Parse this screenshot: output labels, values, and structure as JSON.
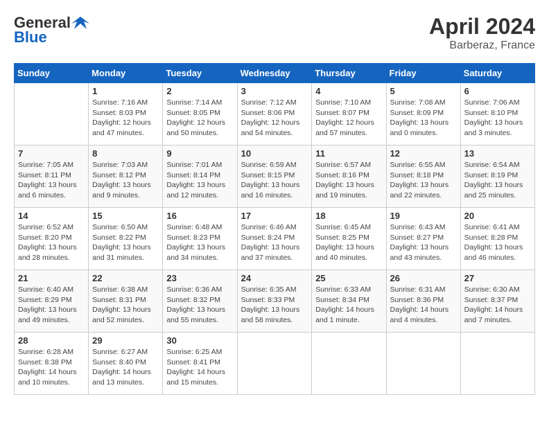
{
  "header": {
    "logo_general": "General",
    "logo_blue": "Blue",
    "month_year": "April 2024",
    "location": "Barberaz, France"
  },
  "days_of_week": [
    "Sunday",
    "Monday",
    "Tuesday",
    "Wednesday",
    "Thursday",
    "Friday",
    "Saturday"
  ],
  "weeks": [
    [
      {
        "day": "",
        "sunrise": "",
        "sunset": "",
        "daylight": ""
      },
      {
        "day": "1",
        "sunrise": "Sunrise: 7:16 AM",
        "sunset": "Sunset: 8:03 PM",
        "daylight": "Daylight: 12 hours and 47 minutes."
      },
      {
        "day": "2",
        "sunrise": "Sunrise: 7:14 AM",
        "sunset": "Sunset: 8:05 PM",
        "daylight": "Daylight: 12 hours and 50 minutes."
      },
      {
        "day": "3",
        "sunrise": "Sunrise: 7:12 AM",
        "sunset": "Sunset: 8:06 PM",
        "daylight": "Daylight: 12 hours and 54 minutes."
      },
      {
        "day": "4",
        "sunrise": "Sunrise: 7:10 AM",
        "sunset": "Sunset: 8:07 PM",
        "daylight": "Daylight: 12 hours and 57 minutes."
      },
      {
        "day": "5",
        "sunrise": "Sunrise: 7:08 AM",
        "sunset": "Sunset: 8:09 PM",
        "daylight": "Daylight: 13 hours and 0 minutes."
      },
      {
        "day": "6",
        "sunrise": "Sunrise: 7:06 AM",
        "sunset": "Sunset: 8:10 PM",
        "daylight": "Daylight: 13 hours and 3 minutes."
      }
    ],
    [
      {
        "day": "7",
        "sunrise": "Sunrise: 7:05 AM",
        "sunset": "Sunset: 8:11 PM",
        "daylight": "Daylight: 13 hours and 6 minutes."
      },
      {
        "day": "8",
        "sunrise": "Sunrise: 7:03 AM",
        "sunset": "Sunset: 8:12 PM",
        "daylight": "Daylight: 13 hours and 9 minutes."
      },
      {
        "day": "9",
        "sunrise": "Sunrise: 7:01 AM",
        "sunset": "Sunset: 8:14 PM",
        "daylight": "Daylight: 13 hours and 12 minutes."
      },
      {
        "day": "10",
        "sunrise": "Sunrise: 6:59 AM",
        "sunset": "Sunset: 8:15 PM",
        "daylight": "Daylight: 13 hours and 16 minutes."
      },
      {
        "day": "11",
        "sunrise": "Sunrise: 6:57 AM",
        "sunset": "Sunset: 8:16 PM",
        "daylight": "Daylight: 13 hours and 19 minutes."
      },
      {
        "day": "12",
        "sunrise": "Sunrise: 6:55 AM",
        "sunset": "Sunset: 8:18 PM",
        "daylight": "Daylight: 13 hours and 22 minutes."
      },
      {
        "day": "13",
        "sunrise": "Sunrise: 6:54 AM",
        "sunset": "Sunset: 8:19 PM",
        "daylight": "Daylight: 13 hours and 25 minutes."
      }
    ],
    [
      {
        "day": "14",
        "sunrise": "Sunrise: 6:52 AM",
        "sunset": "Sunset: 8:20 PM",
        "daylight": "Daylight: 13 hours and 28 minutes."
      },
      {
        "day": "15",
        "sunrise": "Sunrise: 6:50 AM",
        "sunset": "Sunset: 8:22 PM",
        "daylight": "Daylight: 13 hours and 31 minutes."
      },
      {
        "day": "16",
        "sunrise": "Sunrise: 6:48 AM",
        "sunset": "Sunset: 8:23 PM",
        "daylight": "Daylight: 13 hours and 34 minutes."
      },
      {
        "day": "17",
        "sunrise": "Sunrise: 6:46 AM",
        "sunset": "Sunset: 8:24 PM",
        "daylight": "Daylight: 13 hours and 37 minutes."
      },
      {
        "day": "18",
        "sunrise": "Sunrise: 6:45 AM",
        "sunset": "Sunset: 8:25 PM",
        "daylight": "Daylight: 13 hours and 40 minutes."
      },
      {
        "day": "19",
        "sunrise": "Sunrise: 6:43 AM",
        "sunset": "Sunset: 8:27 PM",
        "daylight": "Daylight: 13 hours and 43 minutes."
      },
      {
        "day": "20",
        "sunrise": "Sunrise: 6:41 AM",
        "sunset": "Sunset: 8:28 PM",
        "daylight": "Daylight: 13 hours and 46 minutes."
      }
    ],
    [
      {
        "day": "21",
        "sunrise": "Sunrise: 6:40 AM",
        "sunset": "Sunset: 8:29 PM",
        "daylight": "Daylight: 13 hours and 49 minutes."
      },
      {
        "day": "22",
        "sunrise": "Sunrise: 6:38 AM",
        "sunset": "Sunset: 8:31 PM",
        "daylight": "Daylight: 13 hours and 52 minutes."
      },
      {
        "day": "23",
        "sunrise": "Sunrise: 6:36 AM",
        "sunset": "Sunset: 8:32 PM",
        "daylight": "Daylight: 13 hours and 55 minutes."
      },
      {
        "day": "24",
        "sunrise": "Sunrise: 6:35 AM",
        "sunset": "Sunset: 8:33 PM",
        "daylight": "Daylight: 13 hours and 58 minutes."
      },
      {
        "day": "25",
        "sunrise": "Sunrise: 6:33 AM",
        "sunset": "Sunset: 8:34 PM",
        "daylight": "Daylight: 14 hours and 1 minute."
      },
      {
        "day": "26",
        "sunrise": "Sunrise: 6:31 AM",
        "sunset": "Sunset: 8:36 PM",
        "daylight": "Daylight: 14 hours and 4 minutes."
      },
      {
        "day": "27",
        "sunrise": "Sunrise: 6:30 AM",
        "sunset": "Sunset: 8:37 PM",
        "daylight": "Daylight: 14 hours and 7 minutes."
      }
    ],
    [
      {
        "day": "28",
        "sunrise": "Sunrise: 6:28 AM",
        "sunset": "Sunset: 8:38 PM",
        "daylight": "Daylight: 14 hours and 10 minutes."
      },
      {
        "day": "29",
        "sunrise": "Sunrise: 6:27 AM",
        "sunset": "Sunset: 8:40 PM",
        "daylight": "Daylight: 14 hours and 13 minutes."
      },
      {
        "day": "30",
        "sunrise": "Sunrise: 6:25 AM",
        "sunset": "Sunset: 8:41 PM",
        "daylight": "Daylight: 14 hours and 15 minutes."
      },
      {
        "day": "",
        "sunrise": "",
        "sunset": "",
        "daylight": ""
      },
      {
        "day": "",
        "sunrise": "",
        "sunset": "",
        "daylight": ""
      },
      {
        "day": "",
        "sunrise": "",
        "sunset": "",
        "daylight": ""
      },
      {
        "day": "",
        "sunrise": "",
        "sunset": "",
        "daylight": ""
      }
    ]
  ]
}
